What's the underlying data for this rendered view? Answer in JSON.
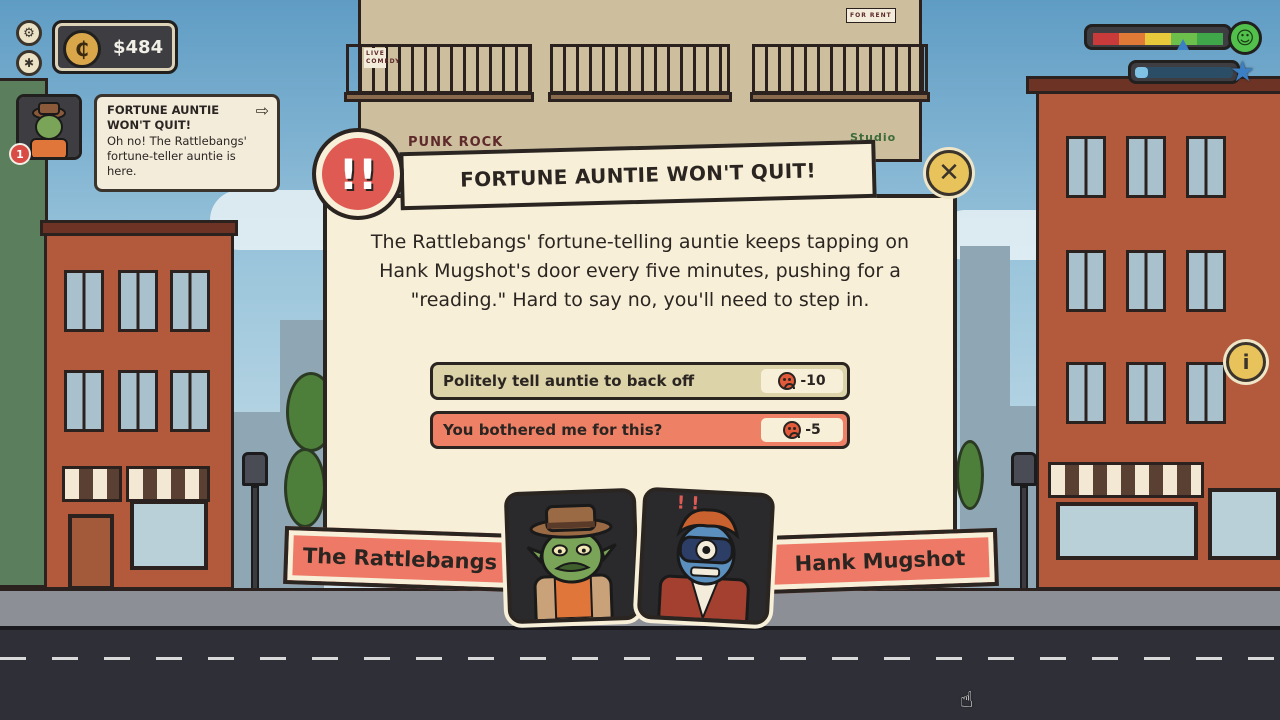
{
  "hud": {
    "money": "$484",
    "coin_symbol": "₵",
    "mood_colors": [
      "#c93b3b",
      "#e27a37",
      "#e9c93c",
      "#6cbf4a",
      "#3fa64a"
    ],
    "mood_level": 0.62,
    "xp_level": 0.12,
    "info_label": "i"
  },
  "notification": {
    "count": "1",
    "title": "FORTUNE AUNTIE WON'T QUIT!",
    "body": "Oh no! The Rattlebangs' fortune-teller auntie is here."
  },
  "signs": {
    "punk_rock": "PUNK ROCK",
    "studio": "Studio",
    "for_rent": "FOR RENT",
    "live_comedy": "LIVE COMEDY"
  },
  "dialog": {
    "title": "FORTUNE AUNTIE WON'T QUIT!",
    "alert_glyph": "!!",
    "close_glyph": "✕",
    "description": "The Rattlebangs' fortune-telling auntie keeps tapping on Hank Mugshot's door every five minutes, pushing for a \"reading.\" Hard to say no, you'll need to step in.",
    "choices": [
      {
        "label": "Politely tell auntie to back off",
        "cost": "-10"
      },
      {
        "label": "You bothered me for this?",
        "cost": "-5"
      }
    ],
    "left_party": "The Rattlebangs",
    "right_party": "Hank Mugshot"
  }
}
